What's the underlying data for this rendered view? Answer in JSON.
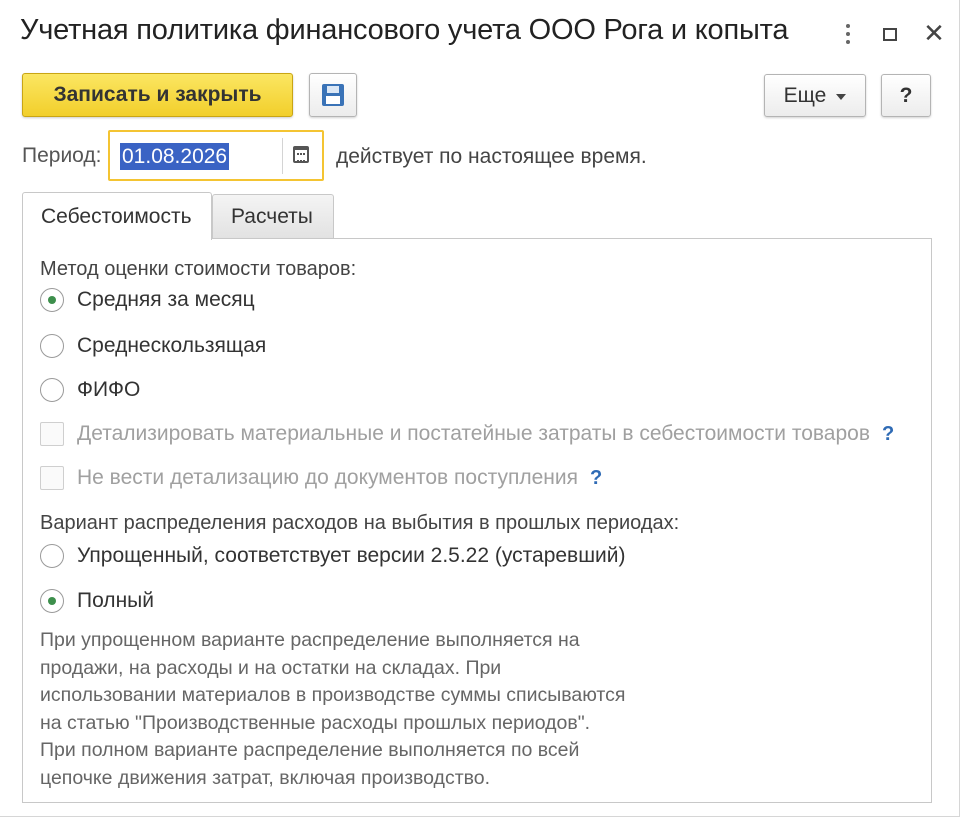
{
  "window": {
    "title": "Учетная политика финансового учета ООО Рога и копыта"
  },
  "toolbar": {
    "save_close_label": "Записать и закрыть",
    "more_label": "Еще",
    "help_label": "?"
  },
  "period": {
    "label": "Период:",
    "value": "01.08.2026",
    "note": "действует по настоящее время."
  },
  "tabs": [
    {
      "label": "Себестоимость",
      "active": true
    },
    {
      "label": "Расчеты",
      "active": false
    }
  ],
  "valuation": {
    "label": "Метод оценки стоимости товаров:",
    "options": [
      {
        "label": "Средняя за месяц",
        "selected": true
      },
      {
        "label": "Среднескользящая",
        "selected": false
      },
      {
        "label": "ФИФО",
        "selected": false
      }
    ]
  },
  "checks": [
    {
      "label": "Детализировать материальные и постатейные затраты в себестоимости товаров",
      "checked": false,
      "enabled": false,
      "hint": "?"
    },
    {
      "label": "Не вести детализацию до документов поступления",
      "checked": false,
      "enabled": false,
      "hint": "?"
    }
  ],
  "distribution": {
    "label": "Вариант распределения расходов на выбытия в прошлых периодах:",
    "options": [
      {
        "label": "Упрощенный, соответствует версии 2.5.22 (устаревший)",
        "selected": false
      },
      {
        "label": "Полный",
        "selected": true
      }
    ],
    "description": "При упрощенном варианте распределение выполняется на\nпродажи, на расходы и на остатки на складах. При\nиспользовании материалов в производстве суммы списываются\nна статью \"Производственные расходы прошлых периодов\".\nПри полном варианте распределение выполняется по всей\nцепочке движения затрат, включая производство."
  }
}
